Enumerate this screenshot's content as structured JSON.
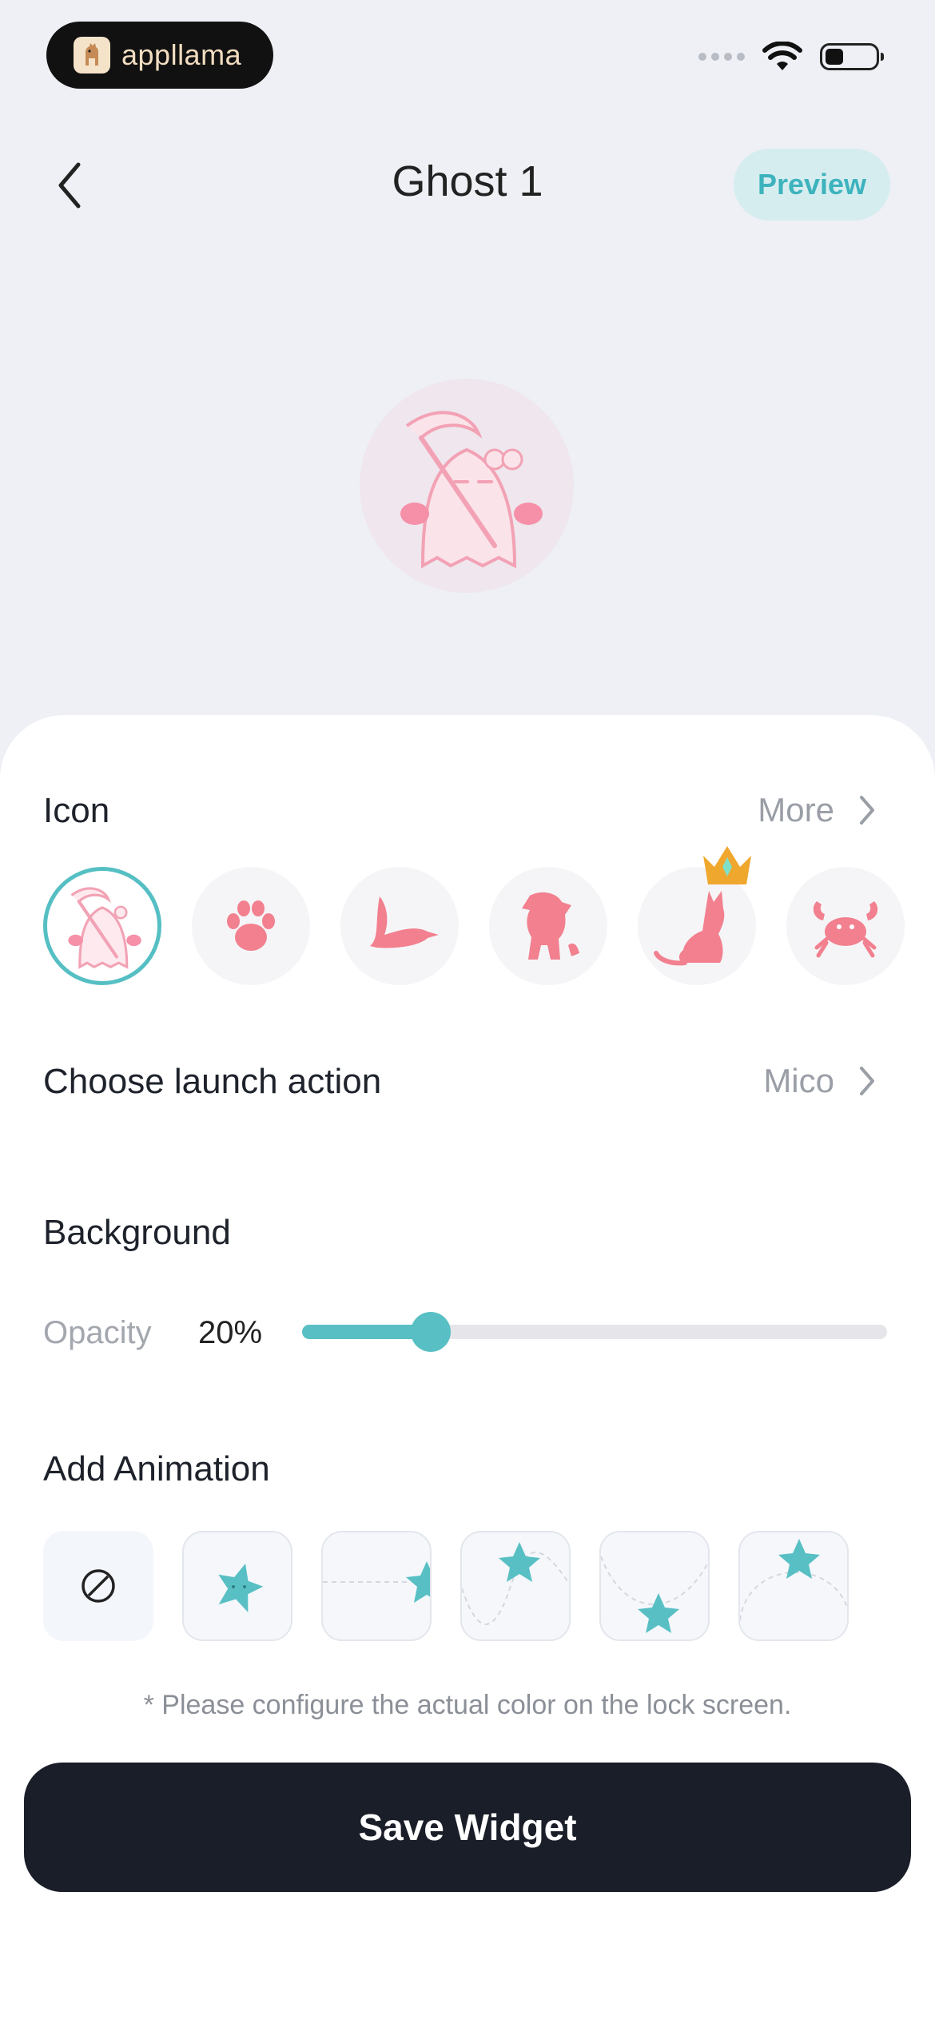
{
  "status": {
    "brand": "appllama"
  },
  "nav": {
    "title": "Ghost 1",
    "preview_label": "Preview"
  },
  "icon_section": {
    "label": "Icon",
    "more_label": "More",
    "icons": [
      "ghost-icon",
      "paw-icon",
      "bird-icon",
      "dog-icon",
      "cat-crown-icon",
      "crab-icon"
    ],
    "selected": "ghost-icon"
  },
  "launch": {
    "label": "Choose launch action",
    "value": "Mico"
  },
  "background": {
    "label": "Background",
    "opacity_label": "Opacity",
    "opacity_value": "20%",
    "opacity_fraction": 0.22
  },
  "animation": {
    "label": "Add Animation",
    "options": [
      "none-icon",
      "star-spin-icon",
      "star-slide-icon",
      "star-wave-icon",
      "star-bounce-icon",
      "star-arc-icon"
    ]
  },
  "note": "* Please configure the actual color on the lock screen.",
  "save_label": "Save Widget",
  "colors": {
    "accent": "#58c0c4",
    "icon_pink": "#f2808f",
    "dark": "#1a1e28"
  }
}
